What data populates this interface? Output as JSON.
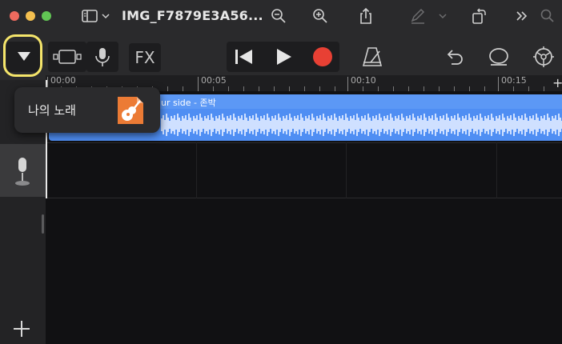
{
  "window": {
    "title": "IMG_F7879E3A56..."
  },
  "toolbar": {
    "fx_label": "FX"
  },
  "ruler": {
    "labels": [
      "00:00",
      "00:05",
      "00:10",
      "00:15"
    ],
    "add_label": "+"
  },
  "popup": {
    "label": "나의 노래"
  },
  "track": {
    "region_title": "ur side - 존박"
  },
  "colors": {
    "region": "#4f8ef3",
    "record": "#e84034",
    "highlight": "#f5e56b"
  },
  "icons": {
    "traffic_lights": [
      "close-icon",
      "minimize-icon",
      "zoom-icon"
    ],
    "titlebar": [
      "sidebar-toggle-icon",
      "chevron-down-icon",
      "zoom-out-icon",
      "zoom-in-icon",
      "share-icon",
      "markup-icon",
      "rotate-icon",
      "more-icon",
      "search-icon"
    ],
    "toolbar": [
      "triangle-down-icon",
      "track-view-icon",
      "microphone-icon",
      "rewind-icon",
      "play-icon",
      "record-icon",
      "metronome-icon",
      "undo-icon",
      "loop-icon",
      "settings-icon"
    ],
    "bottom": "plus-icon"
  }
}
